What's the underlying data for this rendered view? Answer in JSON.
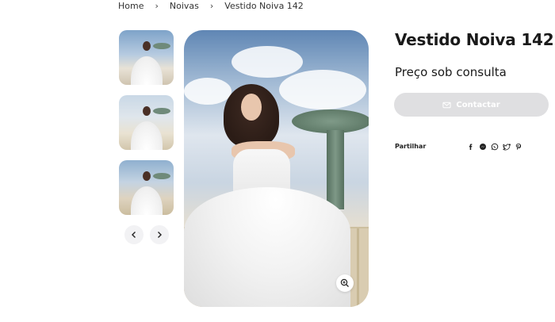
{
  "breadcrumb": {
    "items": [
      "Home",
      "Noivas",
      "Vestido Noiva 142"
    ],
    "separator": "›"
  },
  "product": {
    "title": "Vestido Noiva 142",
    "price": "Preço sob consulta",
    "contact_label": "Contactar",
    "share_label": "Partilhar"
  },
  "gallery": {
    "thumbnails": [
      "thumb-1",
      "thumb-2",
      "thumb-3"
    ],
    "prev_icon": "chevron-left-icon",
    "next_icon": "chevron-right-icon",
    "zoom_icon": "zoom-in-icon"
  },
  "share": {
    "icons": [
      "facebook-icon",
      "messenger-icon",
      "whatsapp-icon",
      "twitter-icon",
      "pinterest-icon"
    ]
  },
  "colors": {
    "text": "#1a1a1a",
    "button_bg": "#dfdfe1",
    "button_text": "#ffffff"
  }
}
